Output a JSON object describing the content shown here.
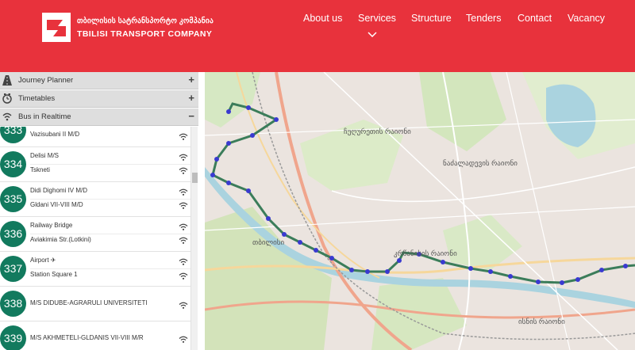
{
  "brand": {
    "name_ka": "თბილისის სატრანსპორტო კომპანია",
    "name_en": "TBILISI TRANSPORT COMPANY",
    "color": "#e8323c"
  },
  "nav": {
    "about": "About us",
    "services": "Services",
    "structure": "Structure",
    "tenders": "Tenders",
    "contact": "Contact",
    "vacancy": "Vacancy"
  },
  "sidebar": {
    "journey_planner": "Journey Planner",
    "timetables": "Timetables",
    "bus_realtime": "Bus in Realtime",
    "plus": "+",
    "minus": "−"
  },
  "routes": [
    {
      "number": "333",
      "stops": [
        "Vazisubani II M/D"
      ]
    },
    {
      "number": "334",
      "stops": [
        "Delisi M/S",
        "Tskneti"
      ]
    },
    {
      "number": "335",
      "stops": [
        "Didi Dighomi IV M/D",
        "Gldani VII-VIII M/D"
      ]
    },
    {
      "number": "336",
      "stops": [
        "Railway Bridge",
        "Aviakimia Str.(Lotkini)"
      ]
    },
    {
      "number": "337",
      "stops": [
        "Airport ✈",
        "Station Square 1"
      ]
    },
    {
      "number": "338",
      "stops": [
        "M/S DIDUBE-AGRARULI UNIVERSITETI"
      ]
    },
    {
      "number": "339",
      "stops": [
        "M/S AKHMETELI-GLDANIS VII-VIII M/R"
      ]
    }
  ],
  "map": {
    "labels": {
      "city": "თბილისი",
      "district_1": "ჩუღურეთის რაიონი",
      "district_2": "კრწანისის რაიონი",
      "district_3": "ისნის რაიონი",
      "district_4": "ნაძალადევის რაიონი"
    },
    "route_color": "#3b7d5a",
    "stop_color": "#3a3ad0"
  }
}
